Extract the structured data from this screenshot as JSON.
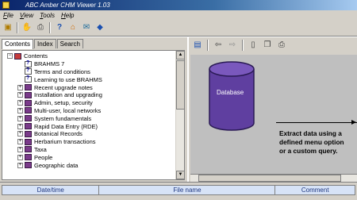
{
  "window": {
    "title": "ABC Amber CHM Viewer 1.03"
  },
  "menu": [
    "File",
    "View",
    "Tools",
    "Help"
  ],
  "toolbar": {
    "icons": [
      "open-icon",
      "hand-icon",
      "print-icon",
      "help-icon",
      "home-icon",
      "mail-icon",
      "info-icon"
    ]
  },
  "tabs": [
    "Contents",
    "Index",
    "Search"
  ],
  "tree": {
    "root": "Contents",
    "items": [
      {
        "label": "BRAHMS 7",
        "type": "page"
      },
      {
        "label": "Terms and conditions",
        "type": "page"
      },
      {
        "label": "Learning to use BRAHMS",
        "type": "page"
      },
      {
        "label": "Recent upgrade notes",
        "type": "book"
      },
      {
        "label": "Installation and upgrading",
        "type": "book"
      },
      {
        "label": "Admin, setup, security",
        "type": "book"
      },
      {
        "label": "Multi-user, local networks",
        "type": "book"
      },
      {
        "label": "System fundamentals",
        "type": "book"
      },
      {
        "label": "Rapid Data Entry (RDE)",
        "type": "book"
      },
      {
        "label": "Botanical Records",
        "type": "book"
      },
      {
        "label": "Herbarium transactions",
        "type": "book"
      },
      {
        "label": "Taxa",
        "type": "book"
      },
      {
        "label": "People",
        "type": "book"
      },
      {
        "label": "Geographic data",
        "type": "book"
      }
    ]
  },
  "content": {
    "db_label": "Database",
    "text_lines": [
      "Extract data using a",
      "defined menu option",
      "or a custom  query."
    ]
  },
  "bottom": {
    "columns": [
      "Date/time",
      "File name",
      "Comment"
    ]
  }
}
